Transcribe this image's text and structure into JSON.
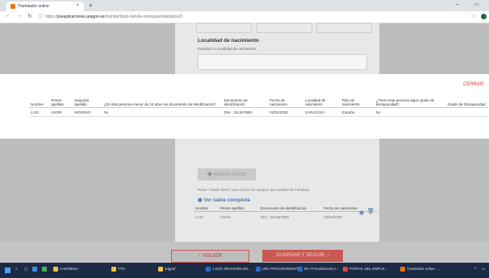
{
  "browser": {
    "tab_title": "Tramitador online",
    "tab_close": "×",
    "new_tab": "+",
    "url_host": "preaplicaciones.aragon.es",
    "url_prefix": "https://",
    "url_path": "/tramitar/titulo-familia-monoparental/datos/3",
    "colors": {
      "tab_favicon": "#e8730c",
      "profile": "#1e6b3a"
    }
  },
  "page": {
    "localidad_title": "Localidad de nacimiento",
    "localidad_hint": "Introduce tu localidad de nacimiento"
  },
  "modal": {
    "close_label": "CERRAR",
    "headers": [
      "Nombre",
      "Primer apellido",
      "Segundo apellido",
      "¿Es esta persona menor de 14 años sin documento de identificación?",
      "Documento de identificación",
      "Fecha de nacimiento",
      "Localidad de nacimiento",
      "País de nacimiento",
      "¿Tiene esta persona algún grado de discapacidad?",
      "Grado de Discapacidad"
    ],
    "rows": [
      [
        "LUIS",
        "USON",
        "MORENO",
        "No",
        "DNI - 25136789D",
        "02/04/2002",
        "ZARAGOZA",
        "España",
        "No",
        ""
      ]
    ]
  },
  "section": {
    "add_label": "AÑADIR DATOS",
    "hint": "Pulsa \"Añadir datos\" para incluir los campos que acabas de introducir",
    "ver_tabla": "Ver tabla completa",
    "table_headers": [
      "Nombre",
      "Primer apellido",
      "Documento de identificación",
      "Fecha de nacimiento"
    ],
    "table_rows": [
      [
        "LUIS",
        "USON",
        "DNI - 25136789D",
        "02/04/2002"
      ]
    ]
  },
  "footer": {
    "volver": "VOLVER",
    "guardar": "GUARDAR Y SEGUIR",
    "colors": {
      "accent": "#c0392b"
    }
  },
  "taskbar": {
    "items": [
      "CARIÑENA",
      "TTO",
      "sdgpef",
      "1 DOC REVISIÓN DG...",
      "URL PROCEDIMIENT...",
      "Re: Procedimiento t...",
      "PORTAL DEL EMPLE...",
      "Tramitador online -..."
    ]
  }
}
